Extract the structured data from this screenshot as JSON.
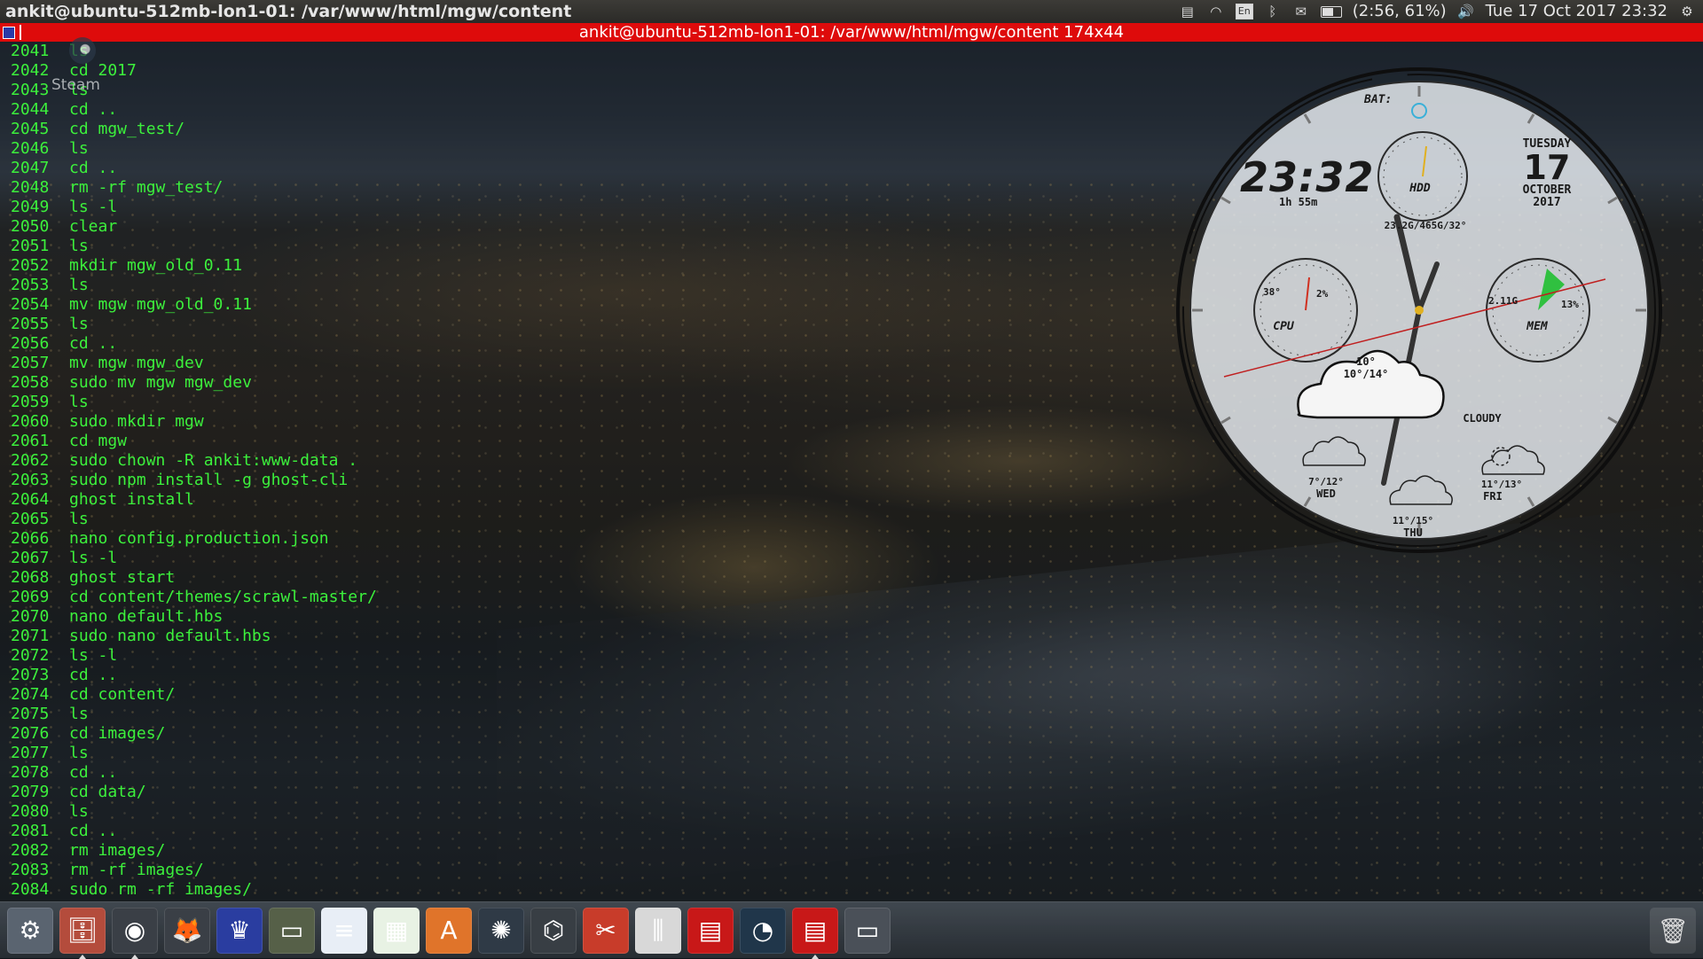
{
  "top_panel": {
    "window_title": "ankit@ubuntu-512mb-lon1-01: /var/www/html/mgw/content",
    "keyboard_layout": "En",
    "battery": "(2:56, 61%)",
    "datetime": "Tue 17 Oct 2017 23:32",
    "icons": [
      "clipboard-icon",
      "wifi-icon",
      "keyboard-icon",
      "bluetooth-icon",
      "mail-icon",
      "battery-icon",
      "volume-icon",
      "gear-icon"
    ]
  },
  "terminal": {
    "title": "ankit@ubuntu-512mb-lon1-01: /var/www/html/mgw/content 174x44",
    "text_color": "#3cf03c",
    "titlebar_color": "#de0b0b",
    "history": [
      {
        "num": "2041",
        "cmd": "ls"
      },
      {
        "num": "2042",
        "cmd": "cd 2017"
      },
      {
        "num": "2043",
        "cmd": "ls"
      },
      {
        "num": "2044",
        "cmd": "cd .."
      },
      {
        "num": "2045",
        "cmd": "cd mgw_test/"
      },
      {
        "num": "2046",
        "cmd": "ls"
      },
      {
        "num": "2047",
        "cmd": "cd .."
      },
      {
        "num": "2048",
        "cmd": "rm -rf mgw_test/"
      },
      {
        "num": "2049",
        "cmd": "ls -l"
      },
      {
        "num": "2050",
        "cmd": "clear"
      },
      {
        "num": "2051",
        "cmd": "ls"
      },
      {
        "num": "2052",
        "cmd": "mkdir mgw_old_0.11"
      },
      {
        "num": "2053",
        "cmd": "ls"
      },
      {
        "num": "2054",
        "cmd": "mv mgw mgw_old_0.11"
      },
      {
        "num": "2055",
        "cmd": "ls"
      },
      {
        "num": "2056",
        "cmd": "cd .."
      },
      {
        "num": "2057",
        "cmd": "mv mgw mgw_dev"
      },
      {
        "num": "2058",
        "cmd": "sudo mv mgw mgw_dev"
      },
      {
        "num": "2059",
        "cmd": "ls"
      },
      {
        "num": "2060",
        "cmd": "sudo mkdir mgw"
      },
      {
        "num": "2061",
        "cmd": "cd mgw"
      },
      {
        "num": "2062",
        "cmd": "sudo chown -R ankit:www-data ."
      },
      {
        "num": "2063",
        "cmd": "sudo npm install -g ghost-cli"
      },
      {
        "num": "2064",
        "cmd": "ghost install"
      },
      {
        "num": "2065",
        "cmd": "ls"
      },
      {
        "num": "2066",
        "cmd": "nano config.production.json"
      },
      {
        "num": "2067",
        "cmd": "ls -l"
      },
      {
        "num": "2068",
        "cmd": "ghost start"
      },
      {
        "num": "2069",
        "cmd": "cd content/themes/scrawl-master/"
      },
      {
        "num": "2070",
        "cmd": "nano default.hbs"
      },
      {
        "num": "2071",
        "cmd": "sudo nano default.hbs"
      },
      {
        "num": "2072",
        "cmd": "ls -l"
      },
      {
        "num": "2073",
        "cmd": "cd .."
      },
      {
        "num": "2074",
        "cmd": "cd content/"
      },
      {
        "num": "2075",
        "cmd": "ls"
      },
      {
        "num": "2076",
        "cmd": "cd images/"
      },
      {
        "num": "2077",
        "cmd": "ls"
      },
      {
        "num": "2078",
        "cmd": "cd .."
      },
      {
        "num": "2079",
        "cmd": "cd data/"
      },
      {
        "num": "2080",
        "cmd": "ls"
      },
      {
        "num": "2081",
        "cmd": "cd .."
      },
      {
        "num": "2082",
        "cmd": "rm images/"
      },
      {
        "num": "2083",
        "cmd": "rm -rf images/"
      },
      {
        "num": "2084",
        "cmd": "sudo rm -rf images/"
      }
    ]
  },
  "desktop": {
    "steam_label": "Steam"
  },
  "widget": {
    "time": "23:32",
    "uptime": "1h 55m",
    "bat_label": "BAT:",
    "day_name": "TUESDAY",
    "day_num": "17",
    "month": "OCTOBER",
    "year": "2017",
    "hdd_label": "HDD",
    "hdd_info": "23.2G/465G/32°",
    "cpu_label": "CPU",
    "cpu_temp": "38°",
    "cpu_pct": "2%",
    "mem_label": "MEM",
    "mem_used": "2.11G",
    "mem_pct": "13%",
    "temp_now": "10°",
    "temp_range": "10°/14°",
    "condition": "CLOUDY",
    "forecast": [
      {
        "temps": "7°/12°",
        "day": "WED"
      },
      {
        "temps": "11°/15°",
        "day": "THU"
      },
      {
        "temps": "11°/13°",
        "day": "FRI"
      }
    ]
  },
  "dock": {
    "items": [
      {
        "name": "ubuntu-settings-icon",
        "glyph": "⚙",
        "bg": "#5a6470",
        "running": false
      },
      {
        "name": "file-manager-icon",
        "glyph": "🗄",
        "bg": "#b44c3c",
        "running": true
      },
      {
        "name": "chrome-icon",
        "glyph": "◉",
        "bg": "#3a3f46",
        "running": true
      },
      {
        "name": "firefox-icon",
        "glyph": "🦊",
        "bg": "#3a3f46",
        "running": false
      },
      {
        "name": "games-icon",
        "glyph": "♛",
        "bg": "#2a3da0",
        "running": false
      },
      {
        "name": "terminal-mini-icon",
        "glyph": "▭",
        "bg": "#566048",
        "running": false
      },
      {
        "name": "writer-icon",
        "glyph": "≡",
        "bg": "#e8eef6",
        "running": false
      },
      {
        "name": "calc-icon",
        "glyph": "▦",
        "bg": "#e8f2e4",
        "running": false
      },
      {
        "name": "software-center-icon",
        "glyph": "A",
        "bg": "#e0742a",
        "running": false
      },
      {
        "name": "swirl-app-icon",
        "glyph": "✺",
        "bg": "#2f3a46",
        "running": false
      },
      {
        "name": "updater-icon",
        "glyph": "⌬",
        "bg": "#383e44",
        "running": false
      },
      {
        "name": "tools-icon",
        "glyph": "✂",
        "bg": "#c83c2a",
        "running": false
      },
      {
        "name": "mixer-icon",
        "glyph": "⫼",
        "bg": "#d8d8d8",
        "running": false
      },
      {
        "name": "red-terminal-icon",
        "glyph": "▤",
        "bg": "#c81818",
        "running": false
      },
      {
        "name": "gauge-icon",
        "glyph": "◔",
        "bg": "#20364a",
        "running": false
      },
      {
        "name": "red-terminal-2-icon",
        "glyph": "▤",
        "bg": "#c81818",
        "running": true
      },
      {
        "name": "window-icon",
        "glyph": "▭",
        "bg": "#4a5058",
        "running": false
      }
    ],
    "trash": {
      "name": "trash-icon",
      "glyph": "🗑"
    }
  }
}
